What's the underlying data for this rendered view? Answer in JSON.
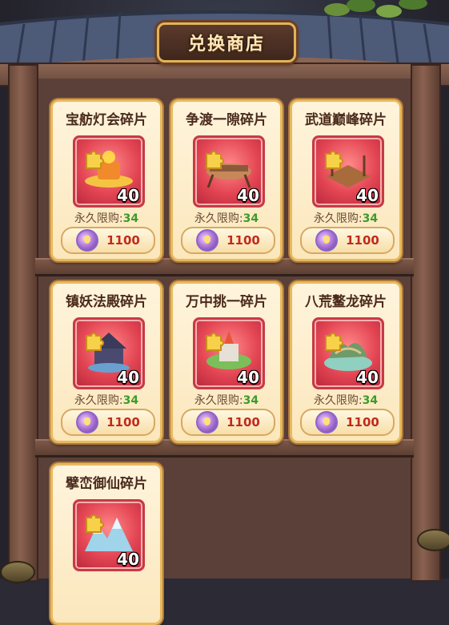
{
  "shop": {
    "title": "兑换商店",
    "limit_label": "永久限购",
    "limit_sep": ":",
    "items": [
      {
        "name": "宝舫灯会碎片",
        "count": "40",
        "limit": "34",
        "price": "1100",
        "icon": "boat-lantern-icon"
      },
      {
        "name": "争渡一隙碎片",
        "count": "40",
        "limit": "34",
        "price": "1100",
        "icon": "ship-icon"
      },
      {
        "name": "武道巅峰碎片",
        "count": "40",
        "limit": "34",
        "price": "1100",
        "icon": "arena-icon"
      },
      {
        "name": "镇妖法殿碎片",
        "count": "40",
        "limit": "34",
        "price": "1100",
        "icon": "demon-temple-icon"
      },
      {
        "name": "万中挑一碎片",
        "count": "40",
        "limit": "34",
        "price": "1100",
        "icon": "tower-icon"
      },
      {
        "name": "八荒鳌龙碎片",
        "count": "40",
        "limit": "34",
        "price": "1100",
        "icon": "dragon-island-icon"
      },
      {
        "name": "擘峦御仙碎片",
        "count": "40",
        "limit": "",
        "price": "",
        "icon": "ice-mountain-icon"
      }
    ]
  },
  "colors": {
    "card_border": "#e8b95d",
    "price": "#c12a1e",
    "limit_number": "#3d9a2a",
    "thumb_bg": "#e34553"
  }
}
